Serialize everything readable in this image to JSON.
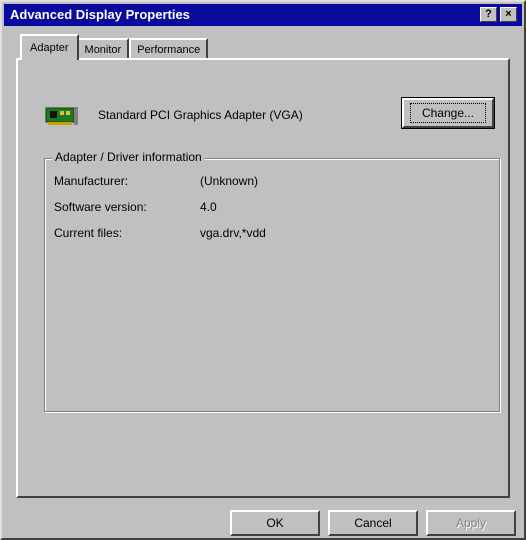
{
  "window": {
    "title": "Advanced Display Properties",
    "help_label": "?",
    "close_label": "×"
  },
  "tabs": [
    {
      "label": "Adapter",
      "active": true
    },
    {
      "label": "Monitor",
      "active": false
    },
    {
      "label": "Performance",
      "active": false
    }
  ],
  "adapter": {
    "name": "Standard PCI Graphics Adapter (VGA)",
    "change_label": "Change...",
    "icon": "display-adapter-card-icon"
  },
  "driver_info": {
    "group_title": "Adapter / Driver information",
    "rows": [
      {
        "label": "Manufacturer:",
        "value": "(Unknown)"
      },
      {
        "label": "Software version:",
        "value": "4.0"
      },
      {
        "label": "Current files:",
        "value": "vga.drv,*vdd"
      }
    ]
  },
  "buttons": {
    "ok": "OK",
    "cancel": "Cancel",
    "apply": "Apply"
  },
  "colors": {
    "titlebar": "#0a0a9e",
    "face": "#c0c0c0"
  }
}
